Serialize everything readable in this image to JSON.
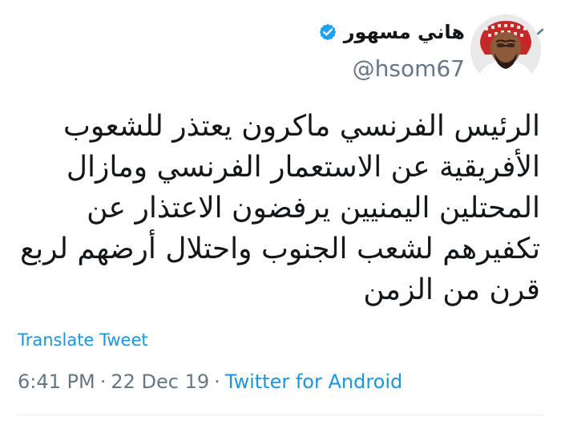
{
  "header": {
    "display_name": "هاني مسهور",
    "handle": "@hsom67",
    "verified_icon": "verified-check-icon",
    "menu_icon": "chevron-down-icon",
    "avatar_icon": "avatar"
  },
  "tweet": {
    "lines": [
      "الرئيس الفرنسي ماكرون يعتذر للشعوب",
      "الأفريقية عن الاستعمار الفرنسي ومازال",
      "المحتلين اليمنيين يرفضون الاعتذار عن",
      "تكفيرهم لشعب الجنوب واحتلال أرضهم لربع",
      "قرن من الزمن"
    ]
  },
  "actions": {
    "translate_label": "Translate Tweet"
  },
  "meta": {
    "time": "6:41 PM",
    "separator_1": "·",
    "date": "22 Dec 19",
    "separator_2": "·",
    "source": "Twitter for Android"
  },
  "colors": {
    "text": "#14171a",
    "muted": "#657786",
    "accent": "#1b95e0",
    "divider": "#e6ecf0"
  }
}
